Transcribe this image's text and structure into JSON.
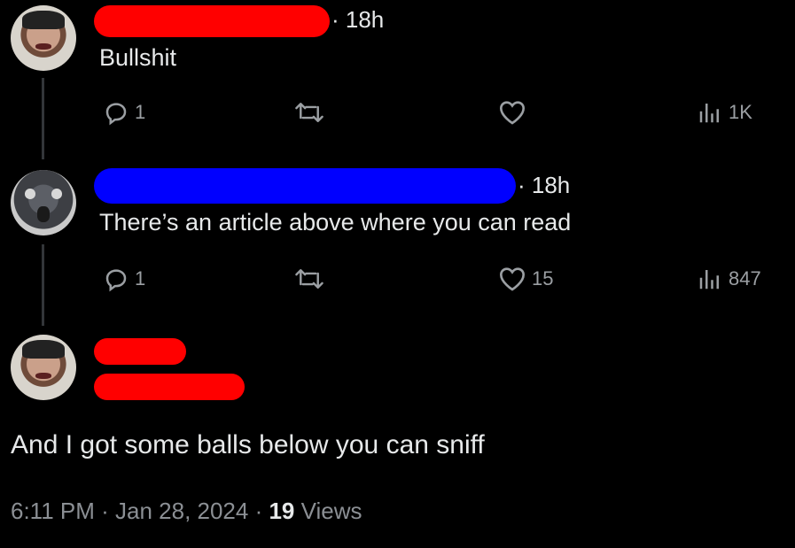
{
  "colors": {
    "background": "#000000",
    "text": "#e7e9ea",
    "muted": "#8b8f94",
    "redact_red": "#ff0000",
    "redact_blue": "#0000ff"
  },
  "tweets": [
    {
      "time": "· 18h",
      "text": "Bullshit",
      "reply_count": "1",
      "like_count": "",
      "view_count": "1K",
      "icons": [
        "reply-icon",
        "retweet-icon",
        "like-icon",
        "views-icon"
      ]
    },
    {
      "time": "· 18h",
      "text": "There’s an article above where you can read",
      "reply_count": "1",
      "like_count": "15",
      "view_count": "847",
      "icons": [
        "reply-icon",
        "retweet-icon",
        "like-icon",
        "views-icon"
      ]
    }
  ],
  "main_tweet": {
    "text": "And I got some balls below you can sniff",
    "timestamp": "6:11 PM · Jan 28, 2024 · ",
    "views_count": "19",
    "views_label": " Views"
  }
}
